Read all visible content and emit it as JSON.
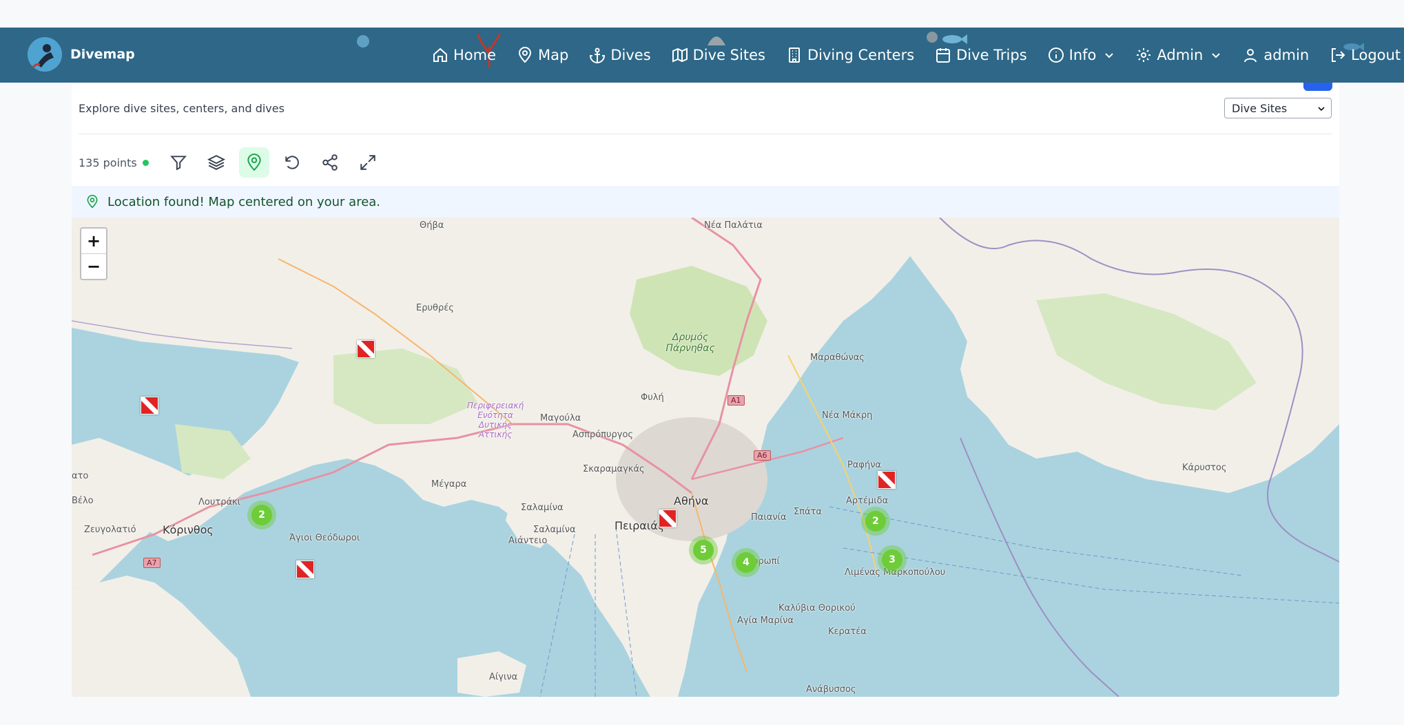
{
  "app": {
    "brand": "Divemap"
  },
  "nav": {
    "items": [
      {
        "label": "Home",
        "icon": "home-icon"
      },
      {
        "label": "Map",
        "icon": "map-pin-icon"
      },
      {
        "label": "Dives",
        "icon": "anchor-icon"
      },
      {
        "label": "Dive Sites",
        "icon": "map-icon"
      },
      {
        "label": "Diving Centers",
        "icon": "building-icon"
      },
      {
        "label": "Dive Trips",
        "icon": "calendar-icon"
      },
      {
        "label": "Info",
        "icon": "info-icon",
        "dropdown": true
      },
      {
        "label": "Admin",
        "icon": "gear-icon",
        "dropdown": true
      },
      {
        "label": "admin",
        "icon": "user-icon"
      },
      {
        "label": "Logout",
        "icon": "logout-icon"
      }
    ]
  },
  "page": {
    "subtitle": "Explore dive sites, centers, and dives",
    "mode_select": {
      "value": "Dive Sites"
    }
  },
  "toolbar": {
    "points_count": "135 points",
    "buttons": [
      "filter-icon",
      "layers-icon",
      "location-icon",
      "reset-icon",
      "share-icon",
      "fullscreen-icon"
    ]
  },
  "notice": {
    "text": "Location found! Map centered on your area."
  },
  "map": {
    "zoom_in": "+",
    "zoom_out": "−",
    "places": {
      "thiva": "Θήβα",
      "nea_palatia": "Νέα Παλάτια",
      "erythres": "Ερυθρές",
      "parnitha": "Δρυμός Πάρνηθας",
      "marathonas": "Μαραθώνας",
      "fyli": "Φυλή",
      "region_west_attica": "Περιφερειακή Ενότητα Δυτικής Αττικής",
      "magoula": "Μαγούλα",
      "aspropyrgos": "Ασπρόπυργος",
      "nea_makri": "Νέα Μάκρη",
      "rafina": "Ραφήνα",
      "skaramagkas": "Σκαραμαγκάς",
      "megara": "Μέγαρα",
      "athina": "Αθήνα",
      "salamina1": "Σαλαμίνα",
      "salamina2": "Σαλαμίνα",
      "artemida": "Αρτέμιδα",
      "karystos": "Κάρυστος",
      "loutraki": "Λουτράκι",
      "paiania": "Παιανία",
      "spata": "Σπάτα",
      "peiraias": "Πειραιάς",
      "zevgolatio": "Ζευγολατιό",
      "korinthos": "Κόρινθος",
      "agioi_theodoroi": "Άγιοι Θεόδωροι",
      "aianteio": "Αιάντειο",
      "kropia": "Κορωπί",
      "markopoulo": "Λιμένας Μαρκοπούλου",
      "kalyvia": "Καλύβια Θορικού",
      "agia_marina": "Αγία Μαρίνα",
      "keratea": "Κερατέα",
      "aigina": "Αίγινα",
      "anavyssos": "Ανάβυσσος",
      "vello": "Βέλο",
      "ato": "ατο"
    },
    "shields": {
      "a1": "A1",
      "a6": "A6",
      "a7": "A7"
    },
    "clusters": {
      "c1": "2",
      "c2": "2",
      "c3": "5",
      "c4": "4",
      "c5": "3"
    }
  }
}
